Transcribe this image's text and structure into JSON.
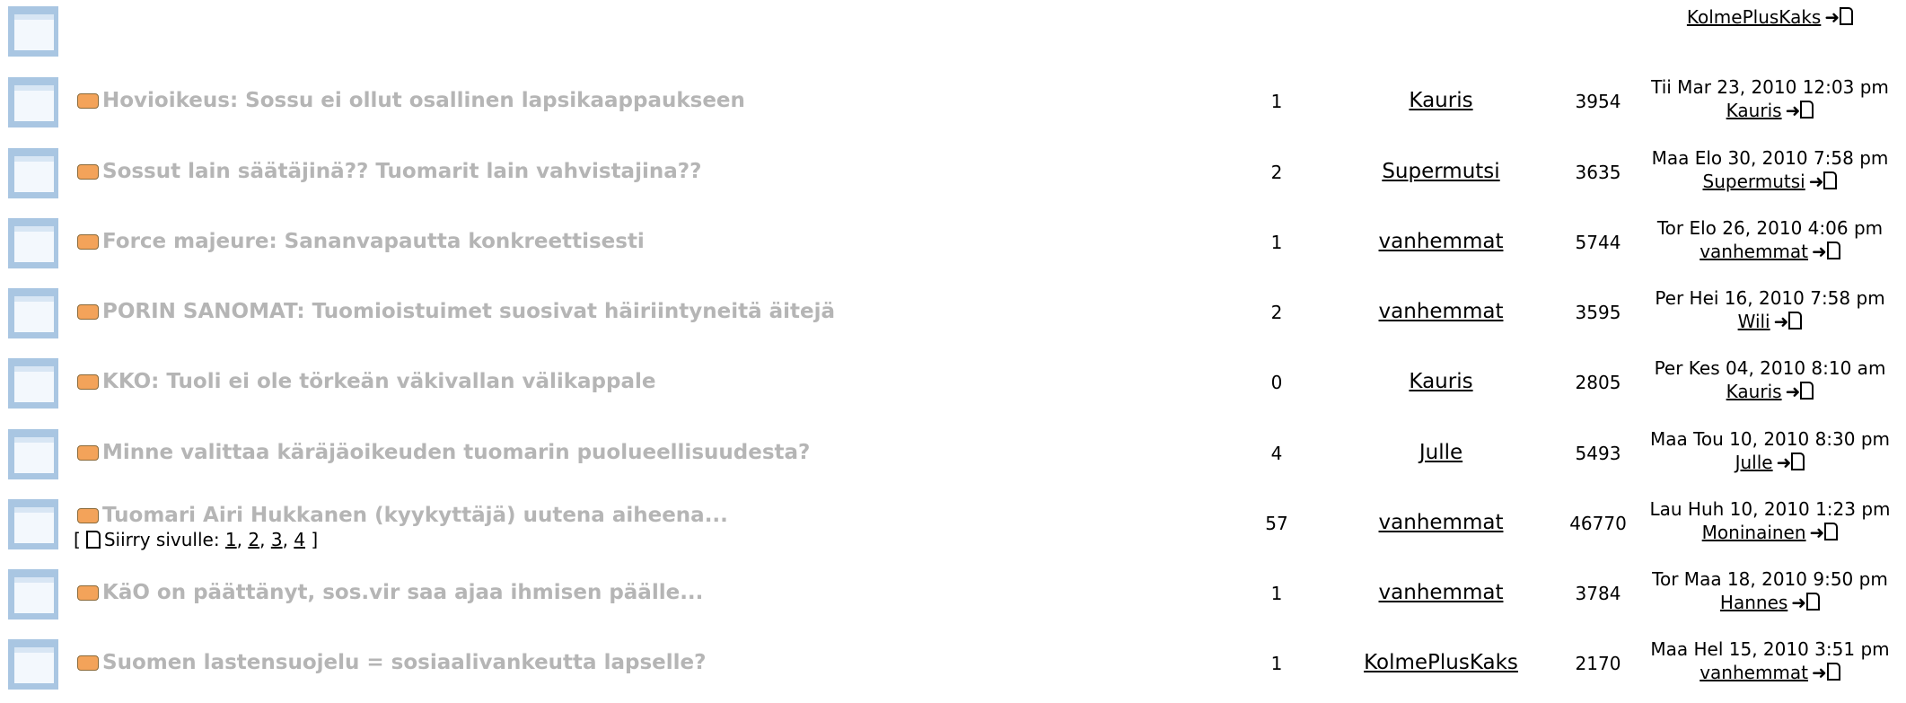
{
  "top_row": {
    "last_author": "KolmePlusKaks"
  },
  "topics": [
    {
      "title": "Hovioikeus: Sossu ei ollut osallinen lapsikaappaukseen",
      "replies": "1",
      "author": "Kauris",
      "views": "3954",
      "last_date": "Tii Mar 23, 2010 12:03 pm",
      "last_author": "Kauris"
    },
    {
      "title": "Sossut lain säätäjinä?? Tuomarit lain vahvistajina??",
      "replies": "2",
      "author": "Supermutsi",
      "views": "3635",
      "last_date": "Maa Elo 30, 2010 7:58 pm",
      "last_author": "Supermutsi"
    },
    {
      "title": "Force majeure: Sananvapautta konkreettisesti",
      "replies": "1",
      "author": "vanhemmat",
      "views": "5744",
      "last_date": "Tor Elo 26, 2010 4:06 pm",
      "last_author": "vanhemmat"
    },
    {
      "title": "PORIN SANOMAT: Tuomioistuimet suosivat häiriintyneitä äitejä",
      "replies": "2",
      "author": "vanhemmat",
      "views": "3595",
      "last_date": "Per Hei 16, 2010 7:58 pm",
      "last_author": "Wili"
    },
    {
      "title": "KKO: Tuoli ei ole törkeän väkivallan välikappale",
      "replies": "0",
      "author": "Kauris",
      "views": "2805",
      "last_date": "Per Kes 04, 2010 8:10 am",
      "last_author": "Kauris"
    },
    {
      "title": "Minne valittaa käräjäoikeuden tuomarin puolueellisuudesta?",
      "replies": "4",
      "author": "Julle",
      "views": "5493",
      "last_date": "Maa Tou 10, 2010 8:30 pm",
      "last_author": "Julle"
    },
    {
      "title": "Tuomari Airi Hukkanen (kyykyttäjä) uutena aiheena...",
      "replies": "57",
      "author": "vanhemmat",
      "views": "46770",
      "last_date": "Lau Huh 10, 2010 1:23 pm",
      "last_author": "Moninainen",
      "pages": {
        "open": "[",
        "label": "Siirry sivulle:",
        "p1": "1",
        "p2": "2",
        "p3": "3",
        "p4": "4",
        "close": "]"
      }
    },
    {
      "title": "KäO on päättänyt, sos.vir saa ajaa ihmisen päälle...",
      "replies": "1",
      "author": "vanhemmat",
      "views": "3784",
      "last_date": "Tor Maa 18, 2010 9:50 pm",
      "last_author": "Hannes"
    },
    {
      "title": "Suomen lastensuojelu = sosiaalivankeutta lapselle?",
      "replies": "1",
      "author": "KolmePlusKaks",
      "views": "2170",
      "last_date": "Maa Hel 15, 2010 3:51 pm",
      "last_author": "vanhemmat"
    }
  ]
}
